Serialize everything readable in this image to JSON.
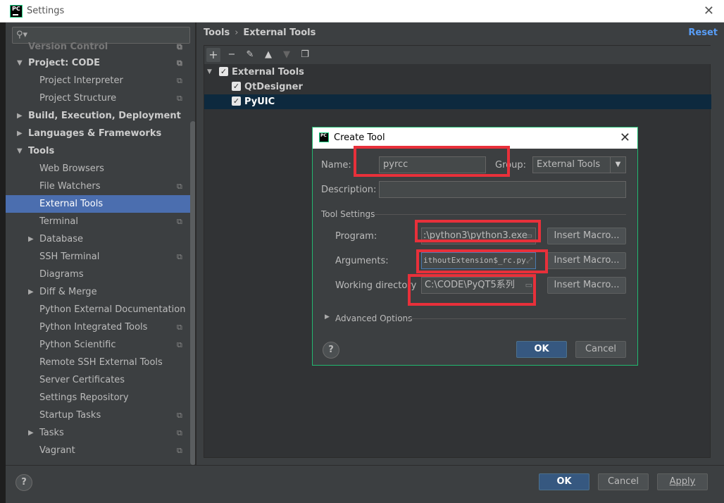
{
  "window": {
    "title": "Settings",
    "logo": "PC"
  },
  "sidebar": {
    "search_placeholder": "",
    "items": [
      {
        "label": "Version Control",
        "level": 0,
        "expand": "none",
        "copy": true,
        "faded": true
      },
      {
        "label": "Project: CODE",
        "level": 0,
        "expand": "open",
        "copy": true,
        "bold": true
      },
      {
        "label": "Project Interpreter",
        "level": 1,
        "copy": true
      },
      {
        "label": "Project Structure",
        "level": 1,
        "copy": true
      },
      {
        "label": "Build, Execution, Deployment",
        "level": 0,
        "expand": "closed",
        "bold": true
      },
      {
        "label": "Languages & Frameworks",
        "level": 0,
        "expand": "closed",
        "bold": true
      },
      {
        "label": "Tools",
        "level": 0,
        "expand": "open",
        "bold": true
      },
      {
        "label": "Web Browsers",
        "level": 1
      },
      {
        "label": "File Watchers",
        "level": 1,
        "copy": true
      },
      {
        "label": "External Tools",
        "level": 1,
        "selected": true
      },
      {
        "label": "Terminal",
        "level": 1,
        "copy": true
      },
      {
        "label": "Database",
        "level": 1,
        "expand": "closed"
      },
      {
        "label": "SSH Terminal",
        "level": 1,
        "copy": true
      },
      {
        "label": "Diagrams",
        "level": 1
      },
      {
        "label": "Diff & Merge",
        "level": 1,
        "expand": "closed"
      },
      {
        "label": "Python External Documentation",
        "level": 1
      },
      {
        "label": "Python Integrated Tools",
        "level": 1,
        "copy": true
      },
      {
        "label": "Python Scientific",
        "level": 1,
        "copy": true
      },
      {
        "label": "Remote SSH External Tools",
        "level": 1
      },
      {
        "label": "Server Certificates",
        "level": 1
      },
      {
        "label": "Settings Repository",
        "level": 1
      },
      {
        "label": "Startup Tasks",
        "level": 1,
        "copy": true
      },
      {
        "label": "Tasks",
        "level": 1,
        "expand": "closed",
        "copy": true
      },
      {
        "label": "Vagrant",
        "level": 1,
        "copy": true
      }
    ]
  },
  "header": {
    "crumb_root": "Tools",
    "crumb_separator": "›",
    "crumb_leaf": "External Tools",
    "reset": "Reset"
  },
  "tool_tree": {
    "group": "External Tools",
    "tools": [
      {
        "label": "QtDesigner",
        "selected": false
      },
      {
        "label": "PyUIC",
        "selected": true
      }
    ]
  },
  "dialog": {
    "title": "Create Tool",
    "name_label": "Name:",
    "name_value": "pyrcc",
    "group_label": "Group:",
    "group_value": "External Tools",
    "description_label": "Description:",
    "description_value": "",
    "section": "Tool Settings",
    "program_label": "Program:",
    "program_value": ":\\python3\\python3.exe",
    "arguments_label": "Arguments:",
    "arguments_value": "ithoutExtension$_rc.py",
    "working_dir_label": "Working directory",
    "working_dir_value": "C:\\CODE\\PyQT5系列",
    "insert_macro": "Insert Macro...",
    "advanced": "Advanced Options",
    "ok": "OK",
    "cancel": "Cancel",
    "help": "?"
  },
  "footer": {
    "help": "?",
    "ok": "OK",
    "cancel": "Cancel",
    "apply": "Apply"
  },
  "colors": {
    "highlight": "#e8303a",
    "selection": "#4b6eaf",
    "accent_link": "#589df6"
  }
}
